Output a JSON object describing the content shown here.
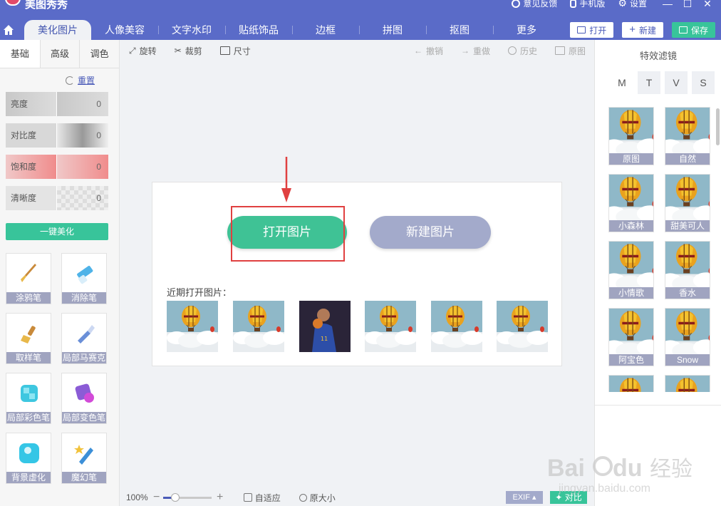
{
  "app": {
    "title": "美图秀秀"
  },
  "titlebar": {
    "feedback": "意见反馈",
    "mobile": "手机版",
    "settings": "设置"
  },
  "tabs": [
    {
      "label": "美化图片",
      "active": true
    },
    {
      "label": "人像美容"
    },
    {
      "label": "文字水印"
    },
    {
      "label": "贴纸饰品"
    },
    {
      "label": "边框"
    },
    {
      "label": "拼图"
    },
    {
      "label": "抠图"
    },
    {
      "label": "更多"
    }
  ],
  "actions": {
    "open": "打开",
    "new": "新建",
    "save": "保存"
  },
  "left": {
    "subtabs": [
      "基础",
      "高级",
      "调色"
    ],
    "reset": "重置",
    "adjust": [
      {
        "label": "亮度",
        "value": "0"
      },
      {
        "label": "对比度",
        "value": "0"
      },
      {
        "label": "饱和度",
        "value": "0"
      },
      {
        "label": "清晰度",
        "value": "0"
      }
    ],
    "one_key": "一键美化",
    "tools": [
      "涂鸦笔",
      "消除笔",
      "取样笔",
      "局部马赛克",
      "局部彩色笔",
      "局部变色笔",
      "背景虚化",
      "魔幻笔"
    ]
  },
  "toolbar": {
    "rotate": "旋转",
    "crop": "裁剪",
    "size": "尺寸",
    "undo": "撤销",
    "redo": "重做",
    "history": "历史",
    "original": "原图"
  },
  "canvas": {
    "open_image": "打开图片",
    "new_image": "新建图片",
    "recent_label": "近期打开图片："
  },
  "bottom": {
    "zoom": "100%",
    "zoom_level": 0.25,
    "fit": "自适应",
    "actual": "原大小",
    "exif": "EXIF",
    "compare": "对比"
  },
  "right": {
    "title": "特效滤镜",
    "filter_tabs": [
      "M",
      "T",
      "V",
      "S"
    ],
    "filters": [
      "原图",
      "自然",
      "小森林",
      "甜美可人",
      "小情歌",
      "香水",
      "阿宝色",
      "Snow"
    ]
  },
  "watermark": {
    "brand": "Baidu",
    "sub": "经验",
    "url": "jingyan.baidu.com"
  },
  "colors": {
    "header": "#5a6bc8",
    "accent": "#38c49a",
    "highlight": "#e04040"
  }
}
